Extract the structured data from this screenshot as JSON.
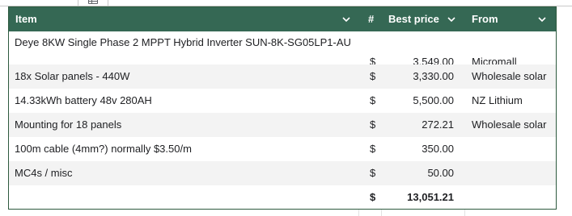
{
  "colors": {
    "header_bg": "#356854",
    "header_text": "#ffffff",
    "alt_row": "#f3f3f3",
    "border": "#2d5a3e"
  },
  "header": {
    "item": "Item",
    "currency": "#",
    "best_price": "Best price",
    "from": "From",
    "dropdown_icon": "chevron-down-icon"
  },
  "rows": [
    {
      "item": "Deye 8KW Single Phase 2 MPPT Hybrid Inverter SUN-8K-SG05LP1-AU",
      "currency": "$",
      "price": "3,549.00",
      "from": "Micromall"
    },
    {
      "item": "18x Solar panels - 440W",
      "currency": "$",
      "price": "3,330.00",
      "from": "Wholesale solar"
    },
    {
      "item": "14.33kWh battery 48v 280AH",
      "currency": "$",
      "price": "5,500.00",
      "from": "NZ Lithium"
    },
    {
      "item": "Mounting for 18 panels",
      "currency": "$",
      "price": "272.21",
      "from": "Wholesale solar"
    },
    {
      "item": "100m cable (4mm?) normally $3.50/m",
      "currency": "$",
      "price": "350.00",
      "from": ""
    },
    {
      "item": "MC4s / misc",
      "currency": "$",
      "price": "50.00",
      "from": ""
    }
  ],
  "total": {
    "currency": "$",
    "price": "13,051.21"
  }
}
